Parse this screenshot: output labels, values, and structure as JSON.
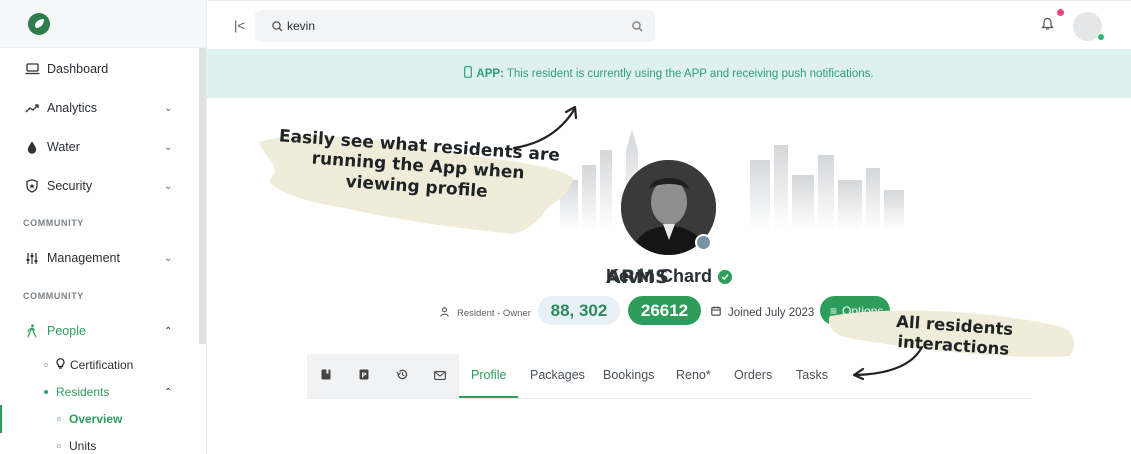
{
  "brand": {
    "name": "ARMS"
  },
  "sidebar": {
    "items": [
      {
        "label": "Dashboard",
        "icon": "laptop-icon"
      },
      {
        "label": "Analytics",
        "icon": "trend-icon"
      },
      {
        "label": "Water",
        "icon": "droplet-icon"
      },
      {
        "label": "Security",
        "icon": "shield-icon"
      },
      {
        "label": "Management",
        "icon": "sliders-icon"
      },
      {
        "label": "People",
        "icon": "person-walk-icon"
      }
    ],
    "sections": [
      "COMMUNITY",
      "COMMUNITY"
    ],
    "subitems": {
      "certification": "Certification",
      "residents": "Residents",
      "overview": "Overview",
      "units": "Units"
    }
  },
  "search": {
    "value": "kevin"
  },
  "banner": {
    "prefix": "APP:",
    "text": "This resident is currently using the APP and receiving push notifications."
  },
  "profile": {
    "name": "Kevin Chard",
    "role": "Resident - Owner",
    "id_value": "88, 302",
    "points_value": "26612",
    "joined": "Joined July 2023",
    "options_label": "Options"
  },
  "tabs": [
    {
      "label": "Profile",
      "active": true
    },
    {
      "label": "Packages",
      "active": false
    },
    {
      "label": "Bookings",
      "active": false
    },
    {
      "label": "Reno*",
      "active": false
    },
    {
      "label": "Orders",
      "active": false
    },
    {
      "label": "Tasks",
      "active": false
    }
  ],
  "annotations": {
    "note1": "Easily see what residents are running the App when viewing profile",
    "note2": "All residents interactions"
  },
  "colors": {
    "accent": "#2e9d5c",
    "banner_bg": "#dff1ed",
    "note_bg": "#efecd9"
  }
}
